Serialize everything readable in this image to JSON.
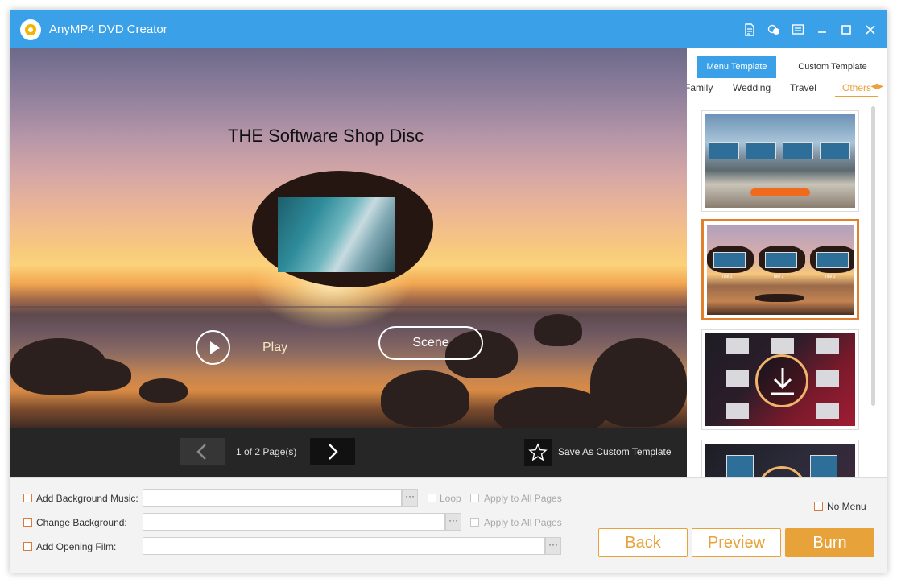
{
  "app": {
    "title": "AnyMP4 DVD Creator"
  },
  "titlebar_icons": [
    "document-icon",
    "chat-icon",
    "menu-icon",
    "minimize-icon",
    "maximize-icon",
    "close-icon"
  ],
  "preview": {
    "disc_title": "THE Software Shop Disc",
    "play_label": "Play",
    "scene_label": "Scene"
  },
  "pager": {
    "indicator": "1 of 2 Page(s)",
    "save_template_label": "Save As Custom Template"
  },
  "right_panel": {
    "tabs": [
      {
        "label": "Menu Template",
        "active": true
      },
      {
        "label": "Custom Template",
        "active": false
      }
    ],
    "categories": [
      "Family",
      "Wedding",
      "Travel",
      "Others"
    ],
    "active_category": "Others",
    "thumb_titles": [
      "Title 1",
      "Title 2",
      "Title 3"
    ]
  },
  "options": {
    "background_music_label": "Add Background Music:",
    "background_music_value": "",
    "loop_label": "Loop",
    "apply_all_1": "Apply to All Pages",
    "change_background_label": "Change Background:",
    "change_background_value": "",
    "apply_all_2": "Apply to All Pages",
    "opening_film_label": "Add Opening Film:",
    "opening_film_value": "",
    "browse": "···",
    "no_menu_label": "No Menu"
  },
  "actions": {
    "back": "Back",
    "preview": "Preview",
    "burn": "Burn"
  },
  "colors": {
    "accent": "#3aa1e8",
    "orange": "#e8a23a",
    "selected_border": "#e0802d"
  }
}
